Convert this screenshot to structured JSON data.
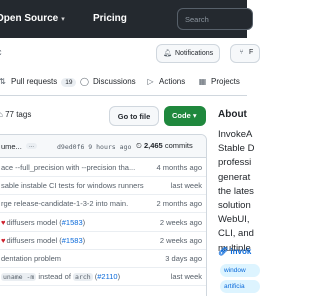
{
  "header": {
    "nav": [
      {
        "label": "Open Source",
        "has_chevron": true
      },
      {
        "label": "Pricing",
        "has_chevron": false
      }
    ],
    "search_placeholder": "Search"
  },
  "repo": {
    "name_fragment": "c",
    "notifications_label": "Notifications",
    "fork_label": "F"
  },
  "tabs": [
    {
      "icon": "pull-request-icon",
      "label": "Pull requests",
      "count": "19"
    },
    {
      "icon": "discussions-icon",
      "label": "Discussions"
    },
    {
      "icon": "actions-icon",
      "label": "Actions"
    },
    {
      "icon": "projects-icon",
      "label": "Projects"
    }
  ],
  "toolbar": {
    "tags_label": "77 tags",
    "go_to_file_label": "Go to file",
    "code_label": "Code"
  },
  "latest_commit": {
    "message": "ume...",
    "dots": "...",
    "sha_text": "d9ed0f6 9 hours ago",
    "commits_count": "2,465",
    "commits_label": "commits"
  },
  "files": [
    {
      "parts": [
        {
          "t": "ace --full_precision with --precision tha..."
        }
      ],
      "time": "4 months ago"
    },
    {
      "parts": [
        {
          "t": "sable instable CI tests for windows runners"
        }
      ],
      "time": "last week"
    },
    {
      "parts": [
        {
          "t": "rge release-candidate-1-3-2 into main."
        }
      ],
      "time": "2 months ago"
    },
    {
      "parts": [
        {
          "t": "diffusers model (",
          "emoji": true
        },
        {
          "t": "#1583",
          "link": true
        },
        {
          "t": ")"
        }
      ],
      "time": "2 weeks ago"
    },
    {
      "parts": [
        {
          "t": "diffusers model (",
          "emoji": true
        },
        {
          "t": "#1583",
          "link": true
        },
        {
          "t": ")"
        }
      ],
      "time": "2 weeks ago"
    },
    {
      "parts": [
        {
          "t": "dentation problem"
        }
      ],
      "time": "3 days ago"
    },
    {
      "parts": [
        {
          "t": "uname -m",
          "mono": true
        },
        {
          "t": " instead of "
        },
        {
          "t": "arch",
          "mono": true
        },
        {
          "t": " ("
        },
        {
          "t": "#2110",
          "link": true
        },
        {
          "t": ")"
        }
      ],
      "time": "last week"
    }
  ],
  "about": {
    "heading": "About",
    "description_lines": [
      "InvokeA",
      "Stable D",
      "professi",
      "generat",
      "the lates",
      "solution",
      "WebUI,",
      "CLI, and",
      "multiple"
    ],
    "link": "invok",
    "topics": [
      "window",
      "artificia"
    ]
  },
  "colors": {
    "header_bg": "#24292f",
    "code_button": "#1f883d",
    "link": "#0969da"
  }
}
